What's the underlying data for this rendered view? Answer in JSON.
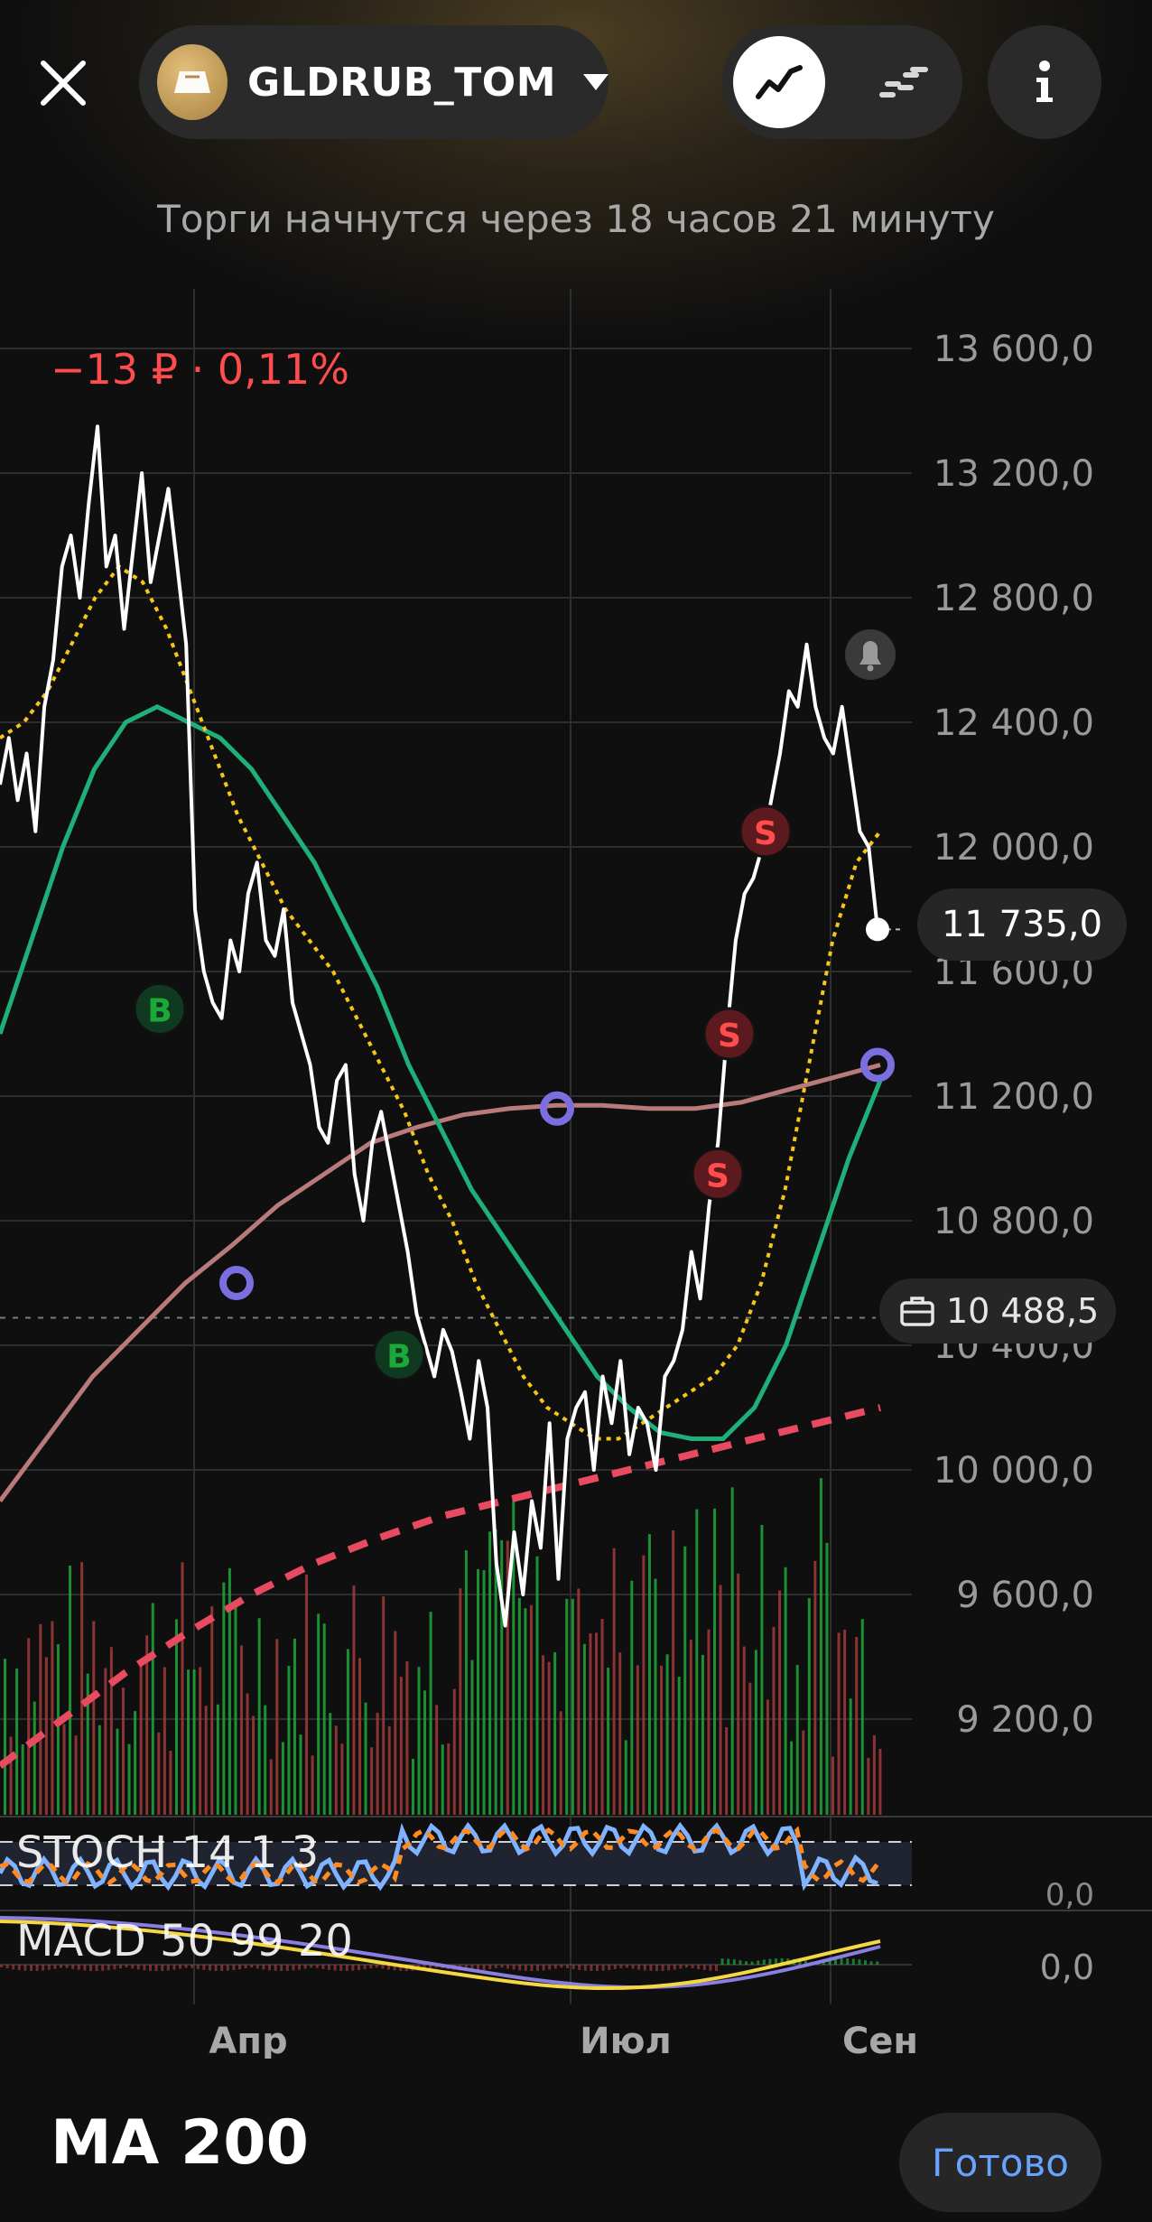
{
  "header": {
    "ticker": "GLDRUB_TOM",
    "close_icon": "close-icon",
    "chart_mode_line_icon": "line-chart-icon",
    "chart_mode_candle_icon": "candlestick-icon",
    "info_icon": "info-icon"
  },
  "status": {
    "message": "Торги начнутся через 18 часов 21 минуту"
  },
  "change": {
    "text": "−13 ₽ · 0,11%"
  },
  "badges": {
    "last_price": "11 735,0",
    "avg_price": "10 488,5"
  },
  "indicators": {
    "stoch": "STOCH 14 1 3",
    "stoch_value": "0,0",
    "macd": "MACD 50 99 20",
    "macd_value": "0,0"
  },
  "footer": {
    "title": "MA 200",
    "done_label": "Готово"
  },
  "colors": {
    "positive": "#1fa83a",
    "negative": "#ff4d4d",
    "accent": "#6aa3ff",
    "ma_green": "#1fb07a",
    "ma_yellow": "#f5c518",
    "ma_pink": "#b87a7a",
    "ma_red_dashed": "#e84a5f",
    "stoch_blue": "#7fb2ff",
    "stoch_orange": "#ff8a1f",
    "marker_purple": "#7b6fe0"
  },
  "chart_data": {
    "type": "line",
    "y_ticks": [
      "13 600,0",
      "13 200,0",
      "12 800,0",
      "12 400,0",
      "12 000,0",
      "11 600,0",
      "11 200,0",
      "10 800,0",
      "10 400,0",
      "10 000,0",
      "9 600,0",
      "9 200,0"
    ],
    "y_tick_values": [
      13600,
      13200,
      12800,
      12400,
      12000,
      11600,
      11200,
      10800,
      10400,
      10000,
      9600,
      9200
    ],
    "x_ticks": [
      "Апр",
      "Июл",
      "Сен"
    ],
    "ylim": [
      8900,
      13800
    ],
    "price": [
      12200,
      12350,
      12150,
      12300,
      12050,
      12450,
      12600,
      12900,
      13000,
      12800,
      13100,
      13350,
      12900,
      13000,
      12700,
      12950,
      13200,
      12850,
      13000,
      13150,
      12900,
      12650,
      11800,
      11600,
      11500,
      11450,
      11700,
      11600,
      11850,
      11950,
      11700,
      11650,
      11800,
      11500,
      11400,
      11300,
      11100,
      11050,
      11250,
      11300,
      10950,
      10800,
      11050,
      11150,
      11000,
      10850,
      10700,
      10500,
      10400,
      10300,
      10450,
      10380,
      10250,
      10100,
      10350,
      10200,
      9700,
      9500,
      9800,
      9600,
      9900,
      9750,
      10150,
      9650,
      10100,
      10200,
      10250,
      10000,
      10300,
      10150,
      10350,
      10050,
      10200,
      10150,
      10000,
      10300,
      10350,
      10450,
      10700,
      10550,
      10850,
      11050,
      11400,
      11700,
      11850,
      11900,
      12000,
      12150,
      12300,
      12500,
      12450,
      12650,
      12450,
      12350,
      12300,
      12450,
      12250,
      12050,
      12000,
      11735
    ],
    "series": [
      {
        "values": [
          12350,
          12400,
          12500,
          12650,
          12800,
          12900,
          12850,
          12700,
          12500,
          12300,
          12100,
          11950,
          11800,
          11700,
          11600,
          11450,
          11300,
          11150,
          10950,
          10800,
          10600,
          10450,
          10300,
          10200,
          10150,
          10100,
          10100,
          10150,
          10200,
          10250,
          10300,
          10400,
          10600,
          10900,
          11300,
          11700,
          11950,
          12050
        ]
      },
      {
        "values": [
          11400,
          11700,
          12000,
          12250,
          12400,
          12450,
          12400,
          12350,
          12250,
          12100,
          11950,
          11750,
          11550,
          11300,
          11100,
          10900,
          10750,
          10600,
          10450,
          10300,
          10200,
          10120,
          10100,
          10100,
          10200,
          10400,
          10700,
          11000,
          11250
        ]
      },
      {
        "values": [
          9900,
          10100,
          10300,
          10450,
          10600,
          10720,
          10850,
          10950,
          11050,
          11100,
          11140,
          11160,
          11170,
          11170,
          11160,
          11160,
          11180,
          11220,
          11260,
          11300
        ]
      },
      {
        "values": [
          9050,
          9200,
          9350,
          9480,
          9600,
          9700,
          9780,
          9850,
          9900,
          9950,
          10000,
          10050,
          10100,
          10150,
          10200
        ]
      }
    ]
  },
  "markers": [
    {
      "label": "B",
      "kind": "buy"
    },
    {
      "label": "B",
      "kind": "buy"
    },
    {
      "label": "S",
      "kind": "sell"
    },
    {
      "label": "S",
      "kind": "sell"
    },
    {
      "label": "S",
      "kind": "sell"
    }
  ]
}
